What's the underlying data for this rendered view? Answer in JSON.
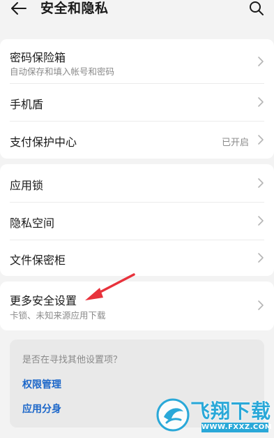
{
  "header": {
    "title": "安全和隐私",
    "back_icon": "arrow-left-icon",
    "search_icon": "search-icon"
  },
  "group1": {
    "items": [
      {
        "label": "密码保险箱",
        "sub": "自动保存和填入帐号和密码"
      },
      {
        "label": "手机盾"
      },
      {
        "label": "支付保护中心",
        "value": "已开启"
      }
    ]
  },
  "group2": {
    "items": [
      {
        "label": "应用锁"
      },
      {
        "label": "隐私空间"
      },
      {
        "label": "文件保密柜"
      }
    ]
  },
  "group3": {
    "items": [
      {
        "label": "更多安全设置",
        "sub": "卡锁、未知来源应用下载"
      }
    ]
  },
  "suggestions": {
    "question": "是否在寻找其他设置项？",
    "links": [
      "权限管理",
      "应用分身"
    ]
  },
  "annotation": {
    "arrow_color": "#e8323c"
  },
  "watermark": {
    "title": "飞翔下载",
    "url": "WWW.FXXZ.COM",
    "color": "#2aa8d8"
  }
}
